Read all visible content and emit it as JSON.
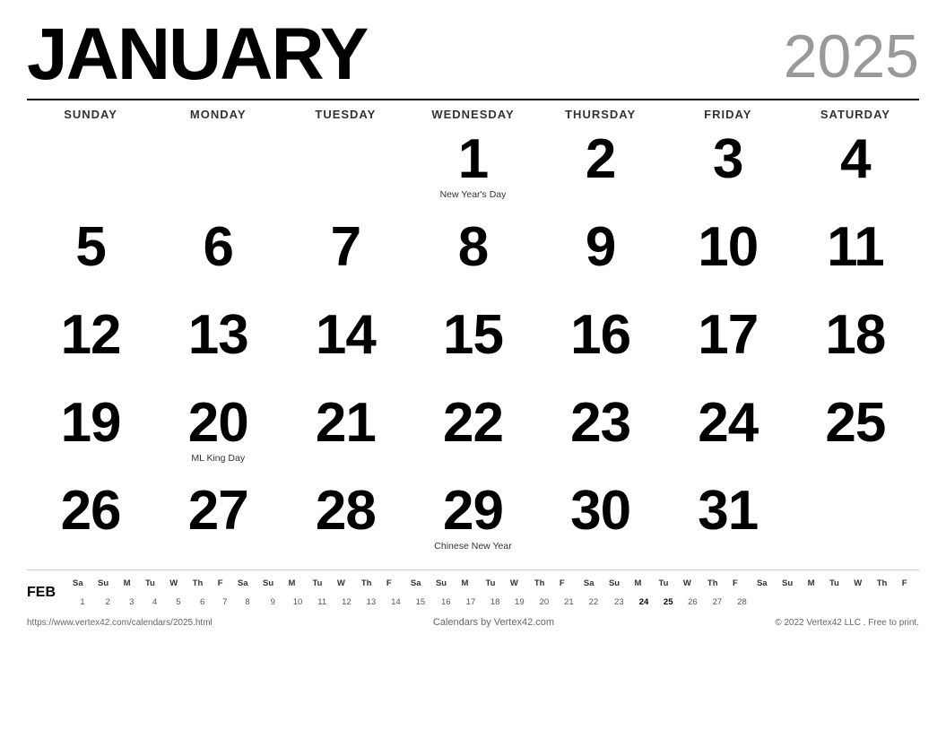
{
  "header": {
    "month": "JANUARY",
    "year": "2025"
  },
  "day_headers": [
    "SUNDAY",
    "MONDAY",
    "TUESDAY",
    "WEDNESDAY",
    "THURSDAY",
    "FRIDAY",
    "SATURDAY"
  ],
  "weeks": [
    [
      {
        "num": "",
        "event": ""
      },
      {
        "num": "",
        "event": ""
      },
      {
        "num": "",
        "event": ""
      },
      {
        "num": "1",
        "event": "New Year's Day"
      },
      {
        "num": "2",
        "event": ""
      },
      {
        "num": "3",
        "event": ""
      },
      {
        "num": "4",
        "event": ""
      }
    ],
    [
      {
        "num": "5",
        "event": ""
      },
      {
        "num": "6",
        "event": ""
      },
      {
        "num": "7",
        "event": ""
      },
      {
        "num": "8",
        "event": ""
      },
      {
        "num": "9",
        "event": ""
      },
      {
        "num": "10",
        "event": ""
      },
      {
        "num": "11",
        "event": ""
      }
    ],
    [
      {
        "num": "12",
        "event": ""
      },
      {
        "num": "13",
        "event": ""
      },
      {
        "num": "14",
        "event": ""
      },
      {
        "num": "15",
        "event": ""
      },
      {
        "num": "16",
        "event": ""
      },
      {
        "num": "17",
        "event": ""
      },
      {
        "num": "18",
        "event": ""
      }
    ],
    [
      {
        "num": "19",
        "event": ""
      },
      {
        "num": "20",
        "event": "ML King Day"
      },
      {
        "num": "21",
        "event": ""
      },
      {
        "num": "22",
        "event": ""
      },
      {
        "num": "23",
        "event": ""
      },
      {
        "num": "24",
        "event": ""
      },
      {
        "num": "25",
        "event": ""
      }
    ],
    [
      {
        "num": "26",
        "event": ""
      },
      {
        "num": "27",
        "event": ""
      },
      {
        "num": "28",
        "event": ""
      },
      {
        "num": "29",
        "event": "Chinese New Year"
      },
      {
        "num": "30",
        "event": ""
      },
      {
        "num": "31",
        "event": ""
      },
      {
        "num": "",
        "event": ""
      }
    ]
  ],
  "mini": {
    "month_label": "FEB",
    "headers": [
      "Sa",
      "Su",
      "M",
      "Tu",
      "W",
      "Th",
      "F",
      "Sa",
      "Su",
      "M",
      "Tu",
      "W",
      "Th",
      "F",
      "Sa",
      "Su",
      "M",
      "Tu",
      "W",
      "Th",
      "F",
      "Sa",
      "Su",
      "M",
      "Tu",
      "W",
      "Th",
      "F",
      "Sa",
      "Su",
      "M",
      "Tu",
      "W",
      "Th",
      "F"
    ],
    "dates": [
      "1",
      "2",
      "3",
      "4",
      "5",
      "6",
      "7",
      "8",
      "9",
      "10",
      "11",
      "12",
      "13",
      "14",
      "15",
      "16",
      "17",
      "18",
      "19",
      "20",
      "21",
      "22",
      "23",
      "24",
      "25",
      "26",
      "27",
      "28",
      "",
      "",
      "",
      "",
      "",
      "",
      ""
    ]
  },
  "footer": {
    "left": "https://www.vertex42.com/calendars/2025.html",
    "center": "Calendars by Vertex42.com",
    "right": "© 2022 Vertex42 LLC . Free to print."
  }
}
